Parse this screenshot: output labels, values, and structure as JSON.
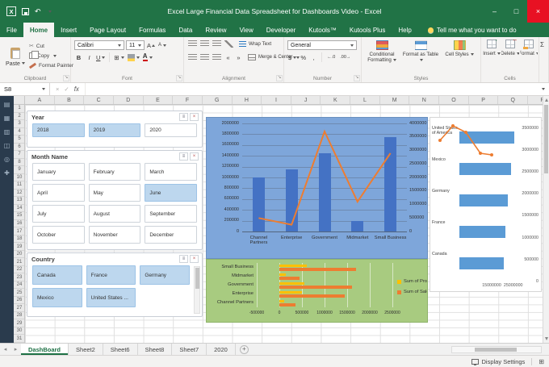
{
  "titlebar": {
    "title": "Excel Large Financial Data Spreadsheet for Dashboards Video - Excel"
  },
  "window_controls": {
    "minimize": "–",
    "maximize": "□",
    "close": "×"
  },
  "ribbon_tabs": [
    {
      "label": "File",
      "type": "file"
    },
    {
      "label": "Home",
      "active": true
    },
    {
      "label": "Insert"
    },
    {
      "label": "Page Layout"
    },
    {
      "label": "Formulas"
    },
    {
      "label": "Data"
    },
    {
      "label": "Review"
    },
    {
      "label": "View"
    },
    {
      "label": "Developer"
    },
    {
      "label": "Kutools™"
    },
    {
      "label": "Kutools Plus"
    },
    {
      "label": "Help"
    }
  ],
  "tell_me": "Tell me what you want to do",
  "ribbon": {
    "clipboard": {
      "label": "Clipboard",
      "paste": "Paste",
      "cut": "Cut",
      "copy": "Copy",
      "format_painter": "Format Painter"
    },
    "font": {
      "label": "Font",
      "font_name": "Calibri",
      "font_size": "11",
      "bold": "B",
      "italic": "I",
      "underline": "U"
    },
    "alignment": {
      "label": "Alignment",
      "wrap_text": "Wrap Text",
      "merge_center": "Merge & Center"
    },
    "number": {
      "label": "Number",
      "format": "General",
      "currency": "$",
      "percent": "%",
      "comma": ","
    },
    "styles": {
      "label": "Styles",
      "items": [
        "Conditional Formatting",
        "Format as Table",
        "Cell Styles"
      ]
    },
    "cells": {
      "label": "Cells",
      "items": [
        "Insert",
        "Delete",
        "Format"
      ]
    }
  },
  "icons": {
    "undo": "↶",
    "cut": "✂",
    "autosum": "Σ",
    "borders": "⊞",
    "indent_decrease": "«",
    "indent_increase": "»",
    "grow_font": "A",
    "shrink_font": "A",
    "font_color": "A",
    "increase_decimal": "←.0",
    "decrease_decimal": ".00→",
    "dialog_launcher": "↘",
    "multiselect": "≡",
    "clear_filter": "×",
    "cancel": "×",
    "enter": "✓",
    "tab_nav_left": "◂",
    "tab_nav_right": "▸",
    "view_grid": "⊞",
    "logo": "X"
  },
  "formula_bar": {
    "name_box": "S8",
    "fx_label": "fx"
  },
  "grid": {
    "columns": [
      "A",
      "B",
      "C",
      "D",
      "E",
      "F",
      "G",
      "H",
      "I",
      "J",
      "K",
      "L",
      "M",
      "N",
      "O",
      "P",
      "Q",
      "R"
    ],
    "rows": [
      "1",
      "2",
      "3",
      "4",
      "5",
      "6",
      "7",
      "8",
      "9",
      "10",
      "11",
      "12",
      "13",
      "14",
      "15",
      "16",
      "17",
      "18",
      "19",
      "20",
      "21",
      "22",
      "23",
      "24",
      "25",
      "26",
      "27",
      "28",
      "29",
      "30",
      "31"
    ]
  },
  "kutools_strip": [
    {
      "name": "navigation-icon",
      "glyph": "▤"
    },
    {
      "name": "worksheets-icon",
      "glyph": "▦"
    },
    {
      "name": "columns-icon",
      "glyph": "▥"
    },
    {
      "name": "clipboard-pane-icon",
      "glyph": "◫"
    },
    {
      "name": "find-icon",
      "glyph": "◎"
    },
    {
      "name": "plus-icon",
      "glyph": "✚"
    }
  ],
  "slicers": [
    {
      "title": "Year",
      "columns": 3,
      "buttons": [
        {
          "label": "2018",
          "selected": true
        },
        {
          "label": "2019",
          "selected": true
        },
        {
          "label": "2020",
          "selected": false
        }
      ]
    },
    {
      "title": "Month Name",
      "columns": 3,
      "buttons": [
        {
          "label": "January",
          "selected": false
        },
        {
          "label": "February",
          "selected": false
        },
        {
          "label": "March",
          "selected": false
        },
        {
          "label": "April",
          "selected": false
        },
        {
          "label": "May",
          "selected": false
        },
        {
          "label": "June",
          "selected": true
        },
        {
          "label": "July",
          "selected": false
        },
        {
          "label": "August",
          "selected": false
        },
        {
          "label": "September",
          "selected": false
        },
        {
          "label": "October",
          "selected": false
        },
        {
          "label": "November",
          "selected": false
        },
        {
          "label": "December",
          "selected": false
        }
      ]
    },
    {
      "title": "Country",
      "columns": 3,
      "scrollbar": true,
      "buttons": [
        {
          "label": "Canada",
          "selected": true
        },
        {
          "label": "France",
          "selected": true
        },
        {
          "label": "Germany",
          "selected": true
        },
        {
          "label": "Mexico",
          "selected": true
        },
        {
          "label": "United States ...",
          "selected": true
        }
      ]
    }
  ],
  "chart_data": [
    {
      "type": "combo-bar-line",
      "categories": [
        "Channel Partners",
        "Enterprise",
        "Government",
        "Midmarket",
        "Small Business"
      ],
      "series": [
        {
          "name": "sales-bars",
          "type": "bar",
          "axis": "left",
          "color": "#4472c4",
          "values": [
            1000000,
            1150000,
            1450000,
            200000,
            1750000
          ]
        },
        {
          "name": "profit-line",
          "type": "line",
          "axis": "right",
          "color": "#ed7d31",
          "values": [
            500000,
            250000,
            3700000,
            1100000,
            2900000
          ]
        }
      ],
      "left_axis": {
        "min": 0,
        "max": 2000000,
        "step": 200000
      },
      "right_axis": {
        "min": 0,
        "max": 4000000,
        "step": 500000
      },
      "background": "#7ea6da"
    },
    {
      "type": "bar",
      "orientation": "horizontal",
      "categories": [
        "Small Business",
        "Midmarket",
        "Government",
        "Enterprise",
        "Channel Partners"
      ],
      "series": [
        {
          "name": "Sum of Profit",
          "color": "#ffc000",
          "values": [
            600000,
            150000,
            550000,
            500000,
            100000
          ]
        },
        {
          "name": "Sum of Sales",
          "color": "#ed7d31",
          "values": [
            1700000,
            450000,
            1600000,
            1450000,
            350000
          ]
        }
      ],
      "x_axis": {
        "min": -500000,
        "max": 2500000,
        "step": 500000
      },
      "legend": {
        "position": "right",
        "entries": [
          "Sum of Profit",
          "Sum of Sales"
        ]
      },
      "background": "#a8cb80"
    },
    {
      "type": "bar",
      "orientation": "horizontal",
      "categories": [
        "United States of America",
        "Mexico",
        "Germany",
        "France",
        "Canada"
      ],
      "series": [
        {
          "name": "country-sales",
          "color": "#5b9bd5",
          "values": [
            25500000,
            24000000,
            22500000,
            21500000,
            20500000
          ]
        }
      ],
      "x_axis": {
        "min": 0,
        "max": 30000000,
        "ticks": [
          15000000,
          25000000
        ]
      },
      "right_axis": {
        "min": 0,
        "max": 3500000,
        "step": 500000
      },
      "overlay_line": {
        "color": "#ed7d31",
        "points": [
          [
            12,
            28
          ],
          [
            28,
            10
          ],
          [
            44,
            18
          ],
          [
            62,
            44
          ],
          [
            76,
            46
          ]
        ]
      },
      "background": "#ffffff"
    }
  ],
  "sheet_tabs": {
    "tabs": [
      {
        "label": "DashBoard",
        "active": true
      },
      {
        "label": "Sheet2"
      },
      {
        "label": "Sheet6"
      },
      {
        "label": "Sheet8"
      },
      {
        "label": "Sheet7"
      },
      {
        "label": "2020"
      }
    ],
    "add_label": "+"
  },
  "status_bar": {
    "display_settings": "Display Settings"
  }
}
